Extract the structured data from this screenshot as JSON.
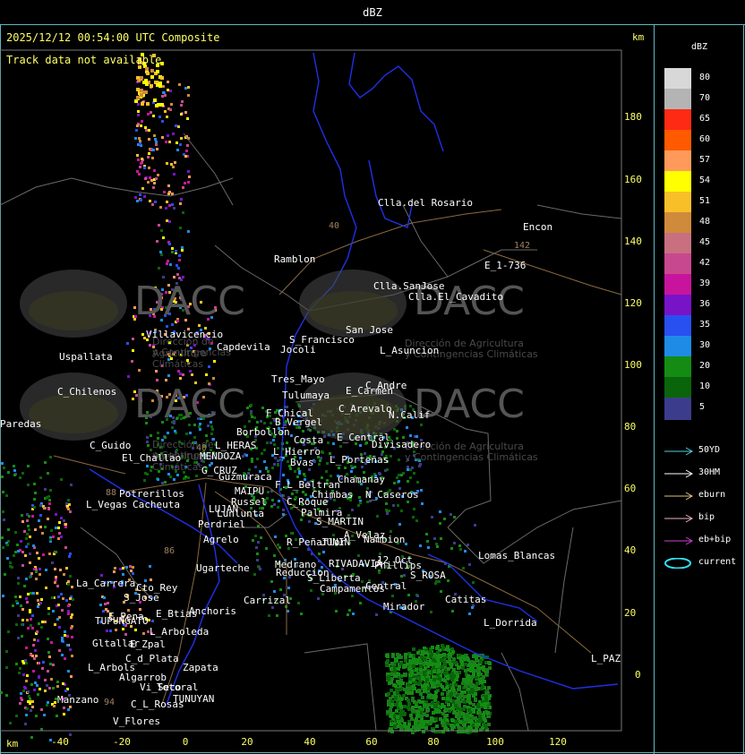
{
  "window": {
    "title": "dBZ"
  },
  "map": {
    "header": "2025/12/12 00:54:00 UTC Composite",
    "track_message": "Track data not available",
    "unit_top": "km",
    "unit_bottom": "km",
    "y_ticks": [
      "180",
      "160",
      "140",
      "120",
      "100",
      "80",
      "60",
      "40",
      "20",
      "0"
    ],
    "x_ticks": [
      "-40",
      "-20",
      "0",
      "20",
      "40",
      "60",
      "80",
      "100",
      "120"
    ],
    "watermark": {
      "brand": "DACC",
      "line1": "Dirección de Agricultura",
      "line2": "y Contingencias Climáticas"
    },
    "places": [
      "Clla.del Rosario",
      "Encon",
      "Ramblon",
      "E_1-736",
      "Clla.SanJose",
      "Clla.El_Cavadito",
      "San Jose",
      "S_Francisco",
      "Jocoli",
      "L_Asuncion",
      "Villavicencio",
      "Capdevila",
      "Uspallata",
      "Tres_Mayo",
      "C_Andre",
      "Tulumaya",
      "E_Carmen",
      "C_Chilenos",
      "C_Arevalo",
      "N.Calif",
      "F_Chical",
      "B_Vergel",
      "Borbollon",
      "Paredas",
      "C_Guido",
      "L_HERAS",
      "Costa",
      "Bvas",
      "E_Central",
      "Divisadero",
      "El_Challao",
      "MENDOZA",
      "L_Hierro",
      "G_CRUZ",
      "F.L_Beltran",
      "L_Porteñas",
      "Guzmuraca",
      "Chamanay",
      "Potrerillos",
      "MAIPU",
      "Russel",
      "Chimbas",
      "N_Caseros",
      "L_Vegas",
      "Cacheuta",
      "LUJAN",
      "C_Roque",
      "Lunlunta",
      "Palmira",
      "Perdriel",
      "S_MARTIN",
      "A_Velaz",
      "Agrelo",
      "Nambion",
      "R_Peñaflor",
      "JUNIN",
      "12_Oct",
      "Ugarteche",
      "Medrano",
      "RIVADAVIA",
      "Phillips",
      "Lomas_Blancas",
      "Reduccion",
      "S_Liberta",
      "S_ROSA",
      "La_Carrera",
      "Cto_Rey",
      "Campamentos",
      "Central",
      "S_Jose",
      "Carrizal",
      "Catitas",
      "Anchoris",
      "E_Pena",
      "E_Btias",
      "TUPUNGATO",
      "Mirador",
      "L_Dorrida",
      "L_Arboleda",
      "Gltallar",
      "E_Zpal",
      "C_d_Plata",
      "L_Arbols",
      "Zapata",
      "L_PAZ",
      "Algarrob",
      "Vi_Seco",
      "Totoral",
      "TUNUYAN",
      "Manzano",
      "C_L_Rosas",
      "V_Flores"
    ],
    "route_numbers": [
      "40",
      "142",
      "40",
      "88",
      "86",
      "94"
    ]
  },
  "legend": {
    "title": "dBZ",
    "scale": [
      {
        "label": "80",
        "color": "#d8d8d8"
      },
      {
        "label": "70",
        "color": "#b4b4b4"
      },
      {
        "label": "65",
        "color": "#ff2a14"
      },
      {
        "label": "60",
        "color": "#ff5a00"
      },
      {
        "label": "57",
        "color": "#ff9a5a"
      },
      {
        "label": "54",
        "color": "#ffff00"
      },
      {
        "label": "51",
        "color": "#f8c028"
      },
      {
        "label": "48",
        "color": "#d08a3c"
      },
      {
        "label": "45",
        "color": "#c87080"
      },
      {
        "label": "42",
        "color": "#c84890"
      },
      {
        "label": "39",
        "color": "#c8149c"
      },
      {
        "label": "36",
        "color": "#7814c8"
      },
      {
        "label": "35",
        "color": "#2850f0"
      },
      {
        "label": "30",
        "color": "#1e8ce6"
      },
      {
        "label": "20",
        "color": "#148c14"
      },
      {
        "label": "10",
        "color": "#0a640a"
      },
      {
        "label": "5",
        "color": "#3c3c8c"
      }
    ],
    "tracks": [
      {
        "label": "50YD",
        "color": "#50d0e0"
      },
      {
        "label": "30HM",
        "color": "#ffffff"
      },
      {
        "label": "eburn",
        "color": "#e0c080"
      },
      {
        "label": "bip",
        "color": "#f0b0c8"
      },
      {
        "label": "eb+bip",
        "color": "#d040d0"
      },
      {
        "label": "current",
        "color": "#30e0f0"
      }
    ]
  }
}
